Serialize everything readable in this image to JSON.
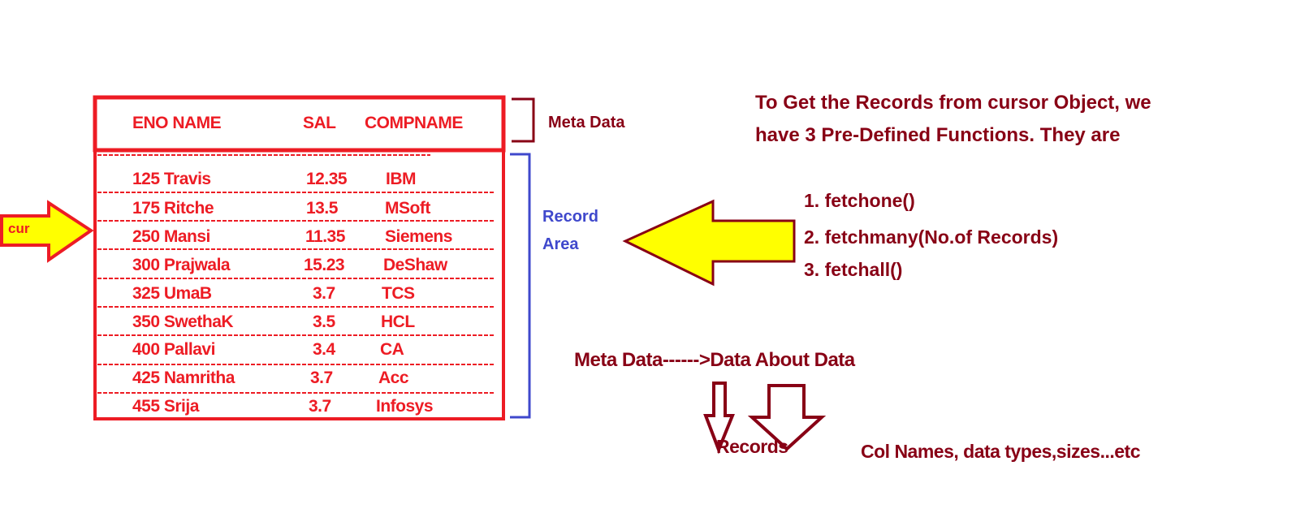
{
  "table": {
    "headers": {
      "eno_name": "ENO NAME",
      "sal": "SAL",
      "compname": "COMPNAME"
    },
    "rows": [
      {
        "eno_name": "125 Travis",
        "sal": "12.35",
        "comp": "IBM"
      },
      {
        "eno_name": "175 Ritche",
        "sal": "13.5",
        "comp": "MSoft"
      },
      {
        "eno_name": "250 Mansi",
        "sal": "11.35",
        "comp": "Siemens"
      },
      {
        "eno_name": "300 Prajwala",
        "sal": "15.23",
        "comp": "DeShaw"
      },
      {
        "eno_name": "325 UmaB",
        "sal": "3.7",
        "comp": "TCS"
      },
      {
        "eno_name": "350 SwethaK",
        "sal": "3.5",
        "comp": "HCL"
      },
      {
        "eno_name": "400 Pallavi",
        "sal": "3.4",
        "comp": "CA"
      },
      {
        "eno_name": "425 Namritha",
        "sal": "3.7",
        "comp": "Acc"
      },
      {
        "eno_name": "455 Srija",
        "sal": "3.7",
        "comp": "Infosys"
      }
    ]
  },
  "labels": {
    "cursor": "cur",
    "meta_data": "Meta Data",
    "record_area_line1": "Record",
    "record_area_line2": "Area"
  },
  "intro": {
    "line1": "To Get the Records from cursor Object, we",
    "line2": "have 3 Pre-Defined Functions. They are"
  },
  "functions": [
    "1. fetchone()",
    "2. fetchmany(No.of Records)",
    "3. fetchall()"
  ],
  "meta_definition": {
    "text": "Meta Data------>Data About Data",
    "records": "Records",
    "columns": "Col Names, data types,sizes...etc"
  },
  "colors": {
    "red": "#ed1c24",
    "maroon": "#880015",
    "blue": "#3f48cc",
    "yellow": "#ffff00"
  }
}
